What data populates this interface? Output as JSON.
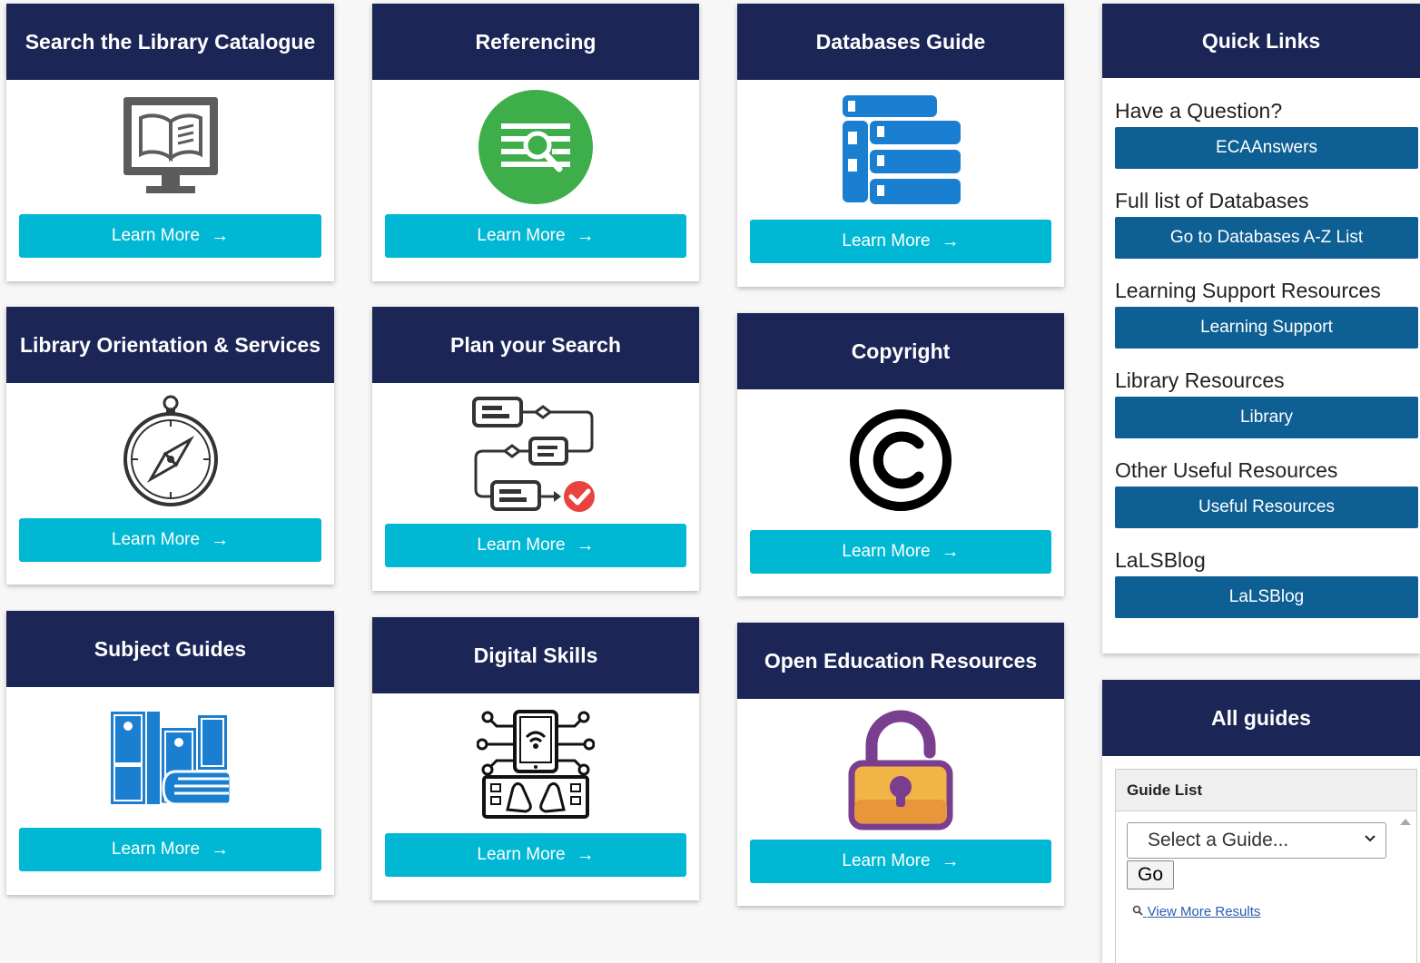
{
  "cards": [
    {
      "title": "Search the Library Catalogue",
      "icon": "monitor-book-icon",
      "button": "Learn More",
      "arrow": "→"
    },
    {
      "title": "Referencing",
      "icon": "magnifier-document-icon",
      "button": "Learn More",
      "arrow": "→"
    },
    {
      "title": "Databases Guide",
      "icon": "database-server-icon",
      "button": "Learn More",
      "arrow": "→"
    },
    {
      "title": "Library Orientation & Services",
      "icon": "compass-icon",
      "button": "Learn More",
      "arrow": "→"
    },
    {
      "title": "Plan your Search",
      "icon": "flowchart-icon",
      "button": "Learn More",
      "arrow": "→"
    },
    {
      "title": "Copyright",
      "icon": "copyright-icon",
      "button": "Learn More",
      "arrow": "→"
    },
    {
      "title": "Subject Guides",
      "icon": "books-icon",
      "button": "Learn More",
      "arrow": "→"
    },
    {
      "title": "Digital Skills",
      "icon": "digital-skills-icon",
      "button": "Learn More",
      "arrow": "→"
    },
    {
      "title": "Open Education Resources",
      "icon": "open-padlock-icon",
      "button": "Learn More",
      "arrow": "→"
    }
  ],
  "quick_links": {
    "title": "Quick Links",
    "items": [
      {
        "label": "Have a Question?",
        "button": "ECAAnswers"
      },
      {
        "label": "Full list of Databases",
        "button": "Go to Databases A-Z List"
      },
      {
        "label": "Learning Support Resources",
        "button": "Learning Support"
      },
      {
        "label": "Library Resources",
        "button": "Library"
      },
      {
        "label": "Other Useful Resources",
        "button": "Useful Resources"
      },
      {
        "label": "LaLSBlog",
        "button": "LaLSBlog"
      }
    ]
  },
  "all_guides": {
    "title": "All guides",
    "box_title": "Guide List",
    "select_value": "Select a Guide...",
    "go_label": "Go",
    "view_more": "View More Results"
  },
  "colors": {
    "header_navy": "#1b2657",
    "learn_button": "#00b8d4",
    "quick_link_button": "#0e5f94",
    "referencing_green": "#3dae49",
    "database_blue": "#1a7fd0"
  }
}
